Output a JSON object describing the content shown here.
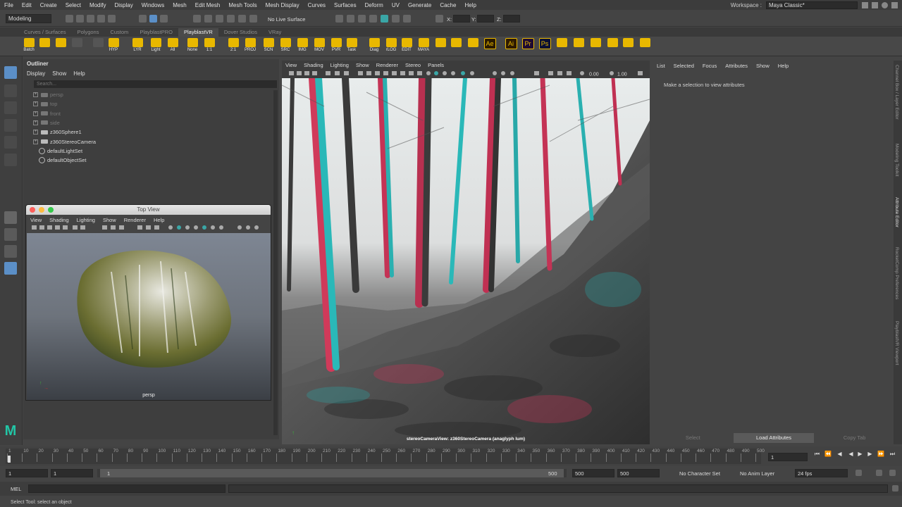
{
  "menubar": {
    "items": [
      "File",
      "Edit",
      "Create",
      "Select",
      "Modify",
      "Display",
      "Windows",
      "Mesh",
      "Edit Mesh",
      "Mesh Tools",
      "Mesh Display",
      "Curves",
      "Surfaces",
      "Deform",
      "UV",
      "Generate",
      "Cache",
      "Help"
    ],
    "workspace_label": "Workspace :",
    "workspace_value": "Maya Classic*"
  },
  "statusline": {
    "mode": "Modeling",
    "live_surface": "No Live Surface",
    "x_label": "X:",
    "y_label": "Y:",
    "z_label": "Z:"
  },
  "shelf_tabs": [
    "Curves / Surfaces",
    "Polygons",
    "Custom",
    "PlayblastPRO",
    "PlayblastVR",
    "Dover Studios",
    "VRay"
  ],
  "shelf_active_tab": "PlayblastVR",
  "shelf_buttons": [
    "Batch",
    "",
    "",
    "",
    "",
    "HYP",
    "LYR",
    "Light",
    "All",
    "None",
    "1:1",
    "2:1",
    "PROJ",
    "SCN",
    "SRC",
    "IMG",
    "MOV",
    "PVR",
    "Task",
    "Diag",
    "rLOG",
    "EDIT",
    "MAYA",
    "",
    "",
    "",
    "Ae",
    "Ai",
    "Pr",
    "Ps",
    "",
    "",
    "",
    "",
    "",
    ""
  ],
  "outliner": {
    "title": "Outliner",
    "menu": [
      "Display",
      "Show",
      "Help"
    ],
    "search_placeholder": "Search...",
    "items": [
      {
        "label": "persp",
        "kind": "camera",
        "dim": true
      },
      {
        "label": "top",
        "kind": "camera",
        "dim": true
      },
      {
        "label": "front",
        "kind": "camera",
        "dim": true
      },
      {
        "label": "side",
        "kind": "camera",
        "dim": true
      },
      {
        "label": "z360Sphere1",
        "kind": "mesh",
        "dim": false
      },
      {
        "label": "z360StereoCamera",
        "kind": "camera",
        "dim": false
      },
      {
        "label": "defaultLightSet",
        "kind": "set",
        "dim": false
      },
      {
        "label": "defaultObjectSet",
        "kind": "set",
        "dim": false
      }
    ]
  },
  "top_view": {
    "title": "Top View",
    "menu": [
      "View",
      "Shading",
      "Lighting",
      "Show",
      "Renderer",
      "Help"
    ],
    "camera_label": "persp"
  },
  "main_viewport": {
    "menu": [
      "View",
      "Shading",
      "Lighting",
      "Show",
      "Renderer",
      "Stereo",
      "Panels"
    ],
    "field_a": "0.00",
    "field_b": "1.00",
    "caption": "stereoCameraView: z360StereoCamera (anaglyph lum)"
  },
  "attribute_editor": {
    "menu": [
      "List",
      "Selected",
      "Focus",
      "Attributes",
      "Show",
      "Help"
    ],
    "message": "Make a selection to view attributes",
    "buttons": [
      "Select",
      "Load Attributes",
      "Copy Tab"
    ]
  },
  "side_tabs": [
    "Channel Box / Layer Editor",
    "Modeling Toolkit",
    "Attribute Editor",
    "RocketComp Preferences",
    "PlayblastVR Viewport"
  ],
  "timeline": {
    "ticks": [
      "1",
      "10",
      "20",
      "30",
      "40",
      "50",
      "60",
      "70",
      "80",
      "90",
      "100",
      "110",
      "120",
      "130",
      "140",
      "150",
      "160",
      "170",
      "180",
      "190",
      "200",
      "210",
      "220",
      "230",
      "240",
      "250",
      "260",
      "270",
      "280",
      "290",
      "300",
      "310",
      "320",
      "330",
      "340",
      "350",
      "360",
      "370",
      "380",
      "390",
      "400",
      "410",
      "420",
      "430",
      "440",
      "450",
      "460",
      "470",
      "480",
      "490",
      "500"
    ],
    "current_frame": "1"
  },
  "range": {
    "start": "1",
    "inner_start": "1",
    "slider_start": "1",
    "slider_end": "500",
    "inner_end": "500",
    "end": "500",
    "character_set": "No Character Set",
    "anim_layer": "No Anim Layer",
    "fps": "24 fps"
  },
  "command": {
    "label": "MEL"
  },
  "help_line": "Select Tool: select an object",
  "colors": {
    "accent_blue": "#5b8fc7",
    "shelf_yellow": "#e8b800",
    "maya_teal": "#22c6a6"
  }
}
